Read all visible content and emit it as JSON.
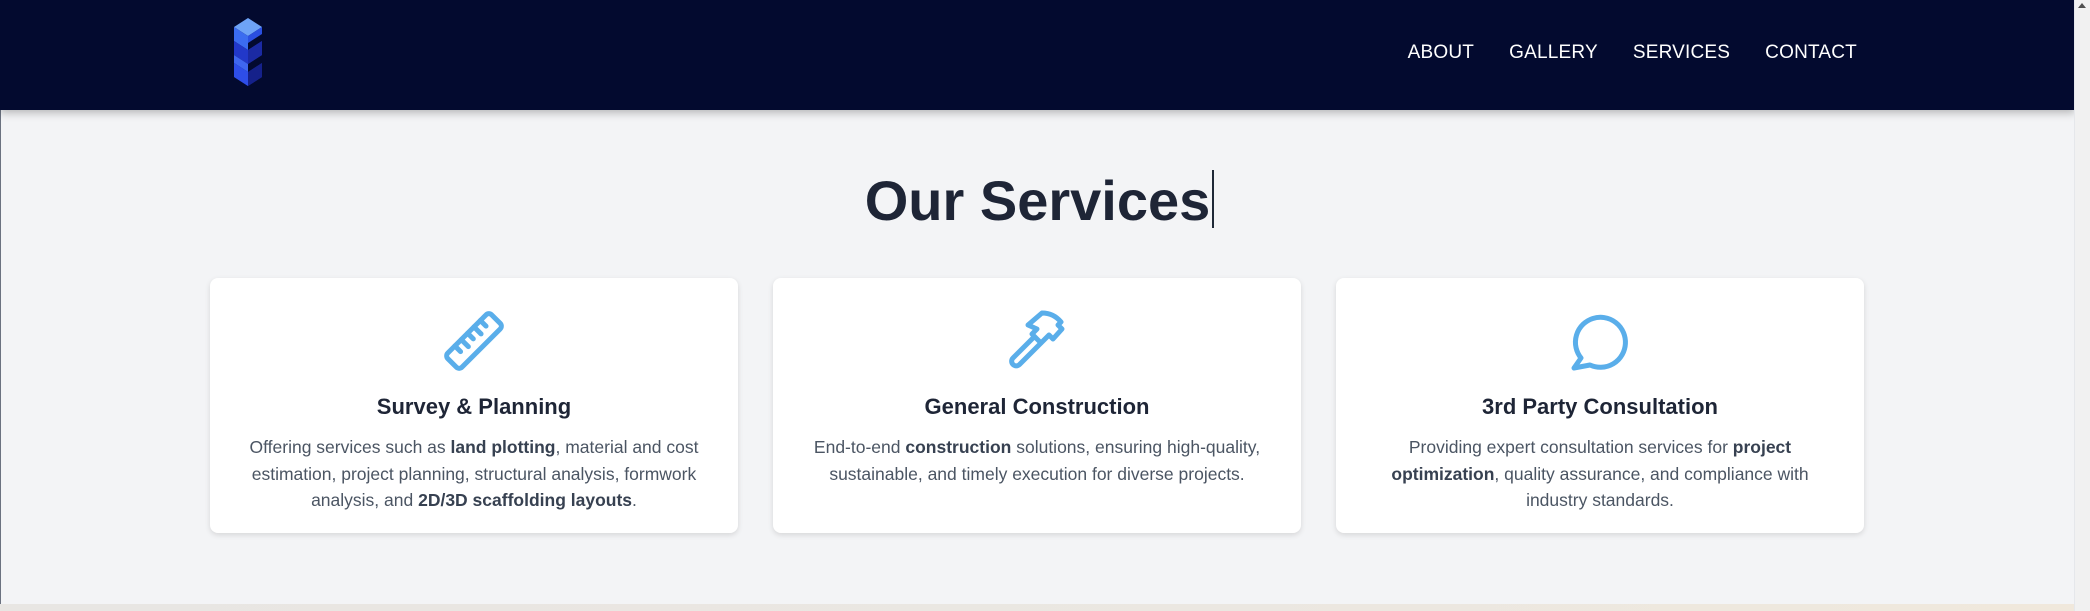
{
  "nav": {
    "logo_icon": "stacked-s-cube-logo",
    "links": [
      "ABOUT",
      "GALLERY",
      "SERVICES",
      "CONTACT"
    ]
  },
  "services": {
    "title": "Our Services",
    "cards": [
      {
        "icon": "ruler-icon",
        "title": "Survey & Planning",
        "text": [
          {
            "t": "Offering services such as ",
            "b": false
          },
          {
            "t": "land plotting",
            "b": true
          },
          {
            "t": ", material and cost estimation, project planning, structural analysis, formwork analysis, and ",
            "b": false
          },
          {
            "t": "2D/3D scaffolding layouts",
            "b": true
          },
          {
            "t": ".",
            "b": false
          }
        ]
      },
      {
        "icon": "hammer-icon",
        "title": "General Construction",
        "text": [
          {
            "t": "End-to-end ",
            "b": false
          },
          {
            "t": "construction",
            "b": true
          },
          {
            "t": " solutions, ensuring high-quality, sustainable, and timely execution for diverse projects.",
            "b": false
          }
        ]
      },
      {
        "icon": "chat-bubble-icon",
        "title": "3rd Party Consultation",
        "text": [
          {
            "t": "Providing expert consultation services for ",
            "b": false
          },
          {
            "t": "project optimization",
            "b": true
          },
          {
            "t": ", quality assurance, and compliance with industry standards.",
            "b": false
          }
        ]
      }
    ]
  },
  "colors": {
    "navbar_bg": "#030a2f",
    "icon_accent": "#5aaeea",
    "page_bg": "#f3f4f6",
    "logo_light": "#4a7df5",
    "logo_dark": "#1f2fb0"
  }
}
